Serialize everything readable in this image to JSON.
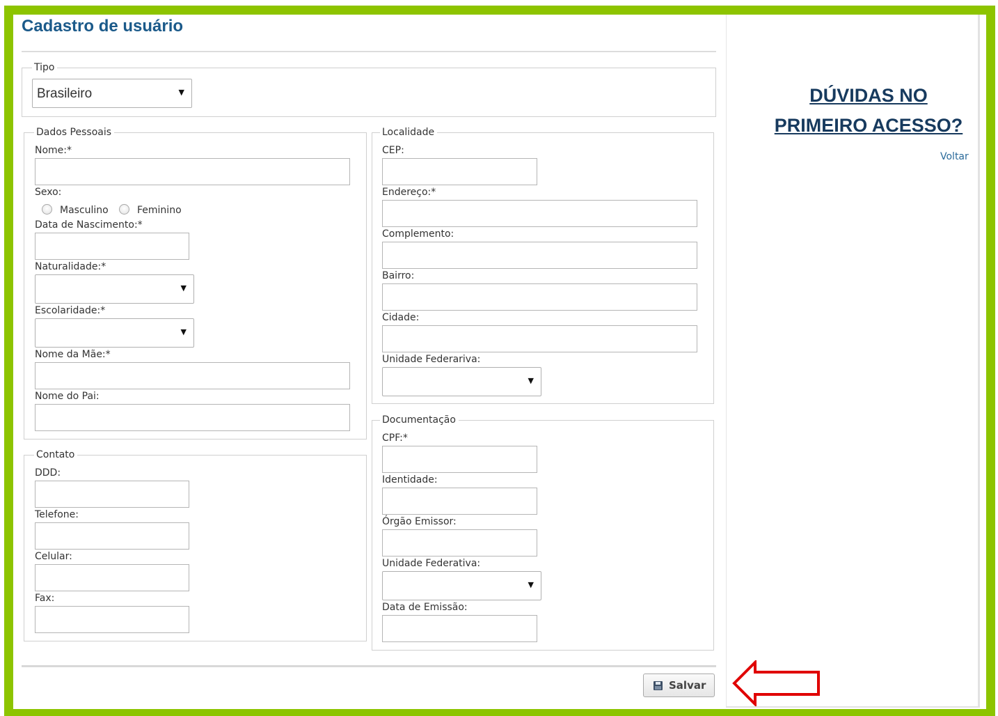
{
  "page": {
    "title": "Cadastro de usuário"
  },
  "tipo": {
    "legend": "Tipo",
    "selected": "Brasileiro"
  },
  "dados_pessoais": {
    "legend": "Dados Pessoais",
    "nome_label": "Nome:*",
    "sexo_label": "Sexo:",
    "sexo_options": [
      "Masculino",
      "Feminino"
    ],
    "nascimento_label": "Data de Nascimento:*",
    "naturalidade_label": "Naturalidade:*",
    "escolaridade_label": "Escolaridade:*",
    "mae_label": "Nome da Mãe:*",
    "pai_label": "Nome do Pai:"
  },
  "contato": {
    "legend": "Contato",
    "ddd_label": "DDD:",
    "telefone_label": "Telefone:",
    "celular_label": "Celular:",
    "fax_label": "Fax:"
  },
  "localidade": {
    "legend": "Localidade",
    "cep_label": "CEP:",
    "endereco_label": "Endereço:*",
    "complemento_label": "Complemento:",
    "bairro_label": "Bairro:",
    "cidade_label": "Cidade:",
    "uf_label": "Unidade Federariva:"
  },
  "documentacao": {
    "legend": "Documentação",
    "cpf_label": "CPF:*",
    "identidade_label": "Identidade:",
    "orgao_label": "Órgão Emissor:",
    "uf_label": "Unidade Federativa:",
    "emissao_label": "Data de Emissão:"
  },
  "sidebar": {
    "help_line1": "DÚVIDAS NO",
    "help_line2": "PRIMEIRO ACESSO?",
    "back_link": "Voltar"
  },
  "actions": {
    "save_label": "Salvar"
  },
  "colors": {
    "frame": "#8dc400",
    "title": "#1b5a8a",
    "help_link": "#173a5e",
    "annotation_arrow": "#e00000"
  },
  "icons": {
    "caret": "caret-down-icon",
    "save": "floppy-disk-icon",
    "annotation": "left-arrow-icon"
  }
}
